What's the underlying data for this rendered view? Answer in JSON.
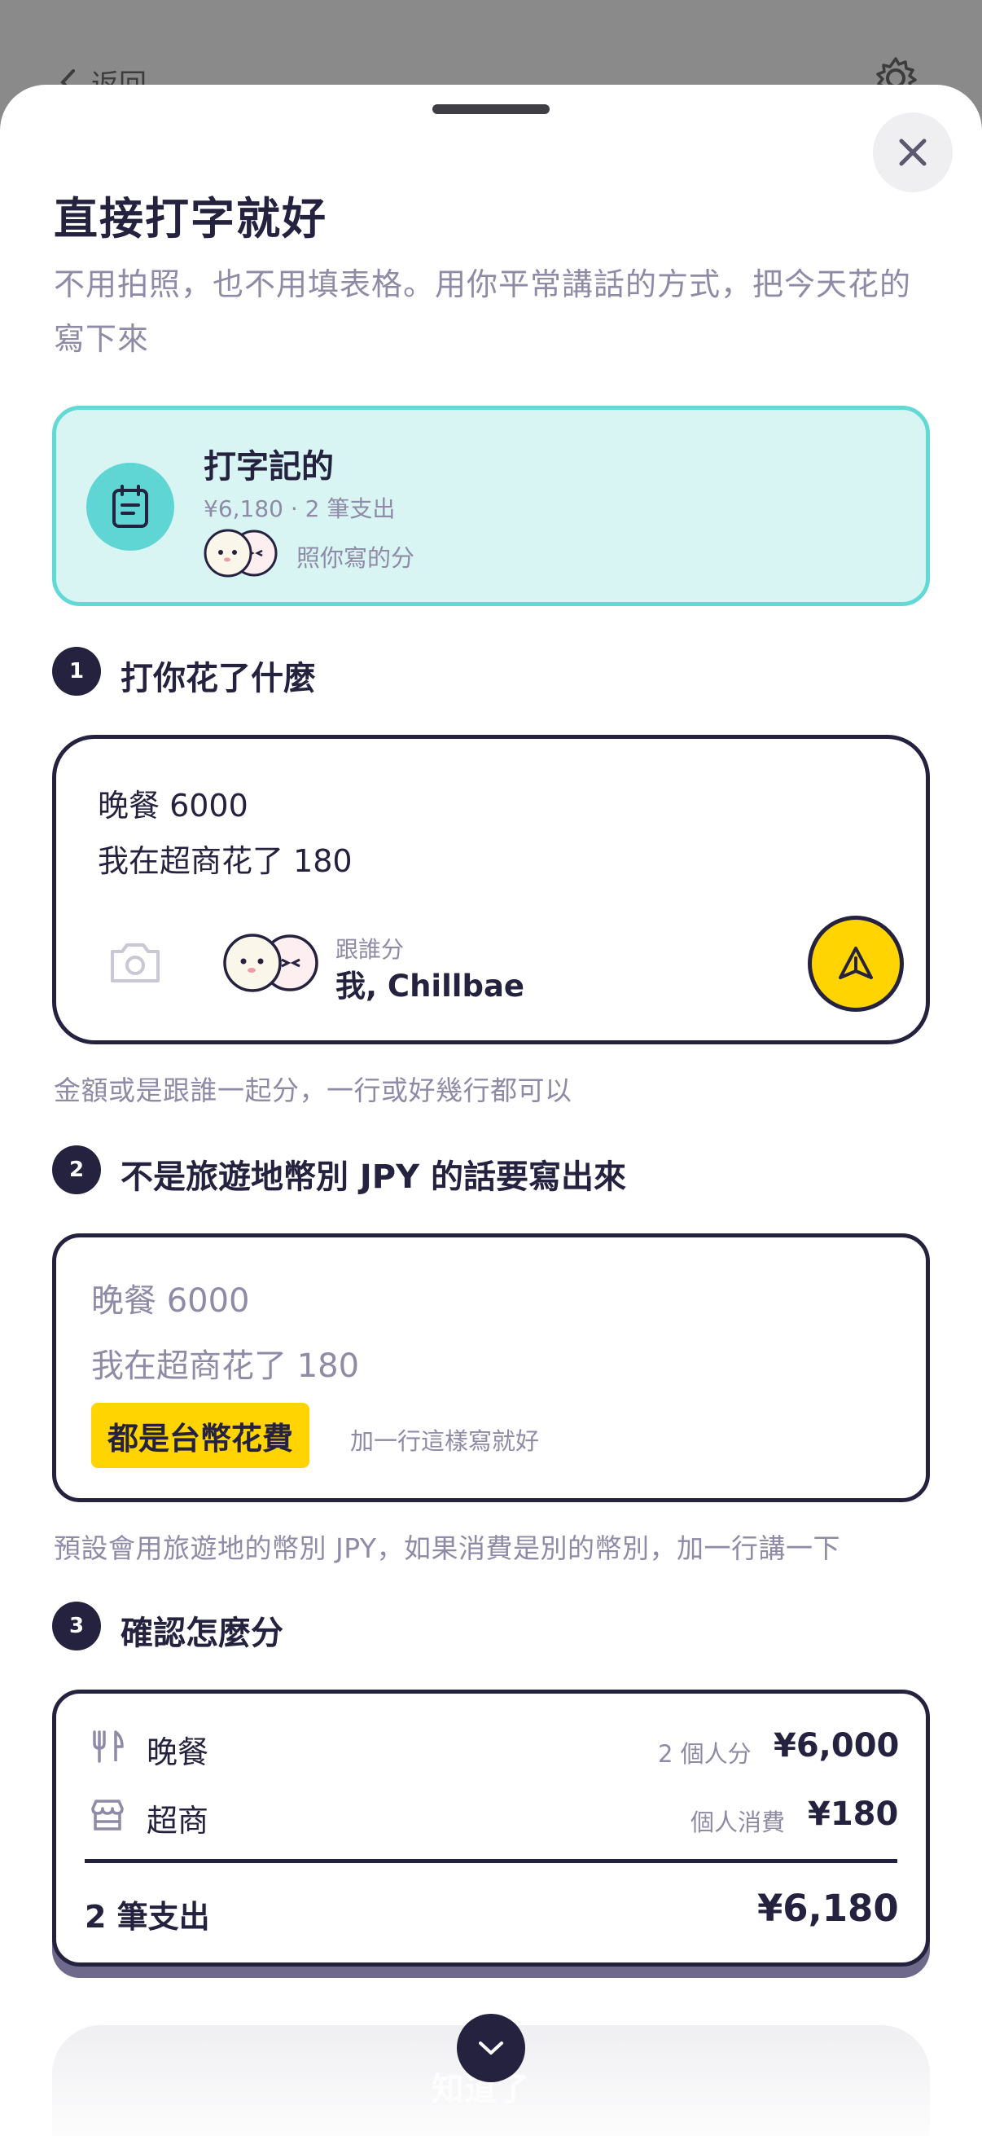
{
  "background_page": {
    "back_label": "返回"
  },
  "sheet": {
    "title": "直接打字就好",
    "subtitle": "不用拍照，也不用填表格。用你平常講話的方式，把今天花的寫下來"
  },
  "mode_card": {
    "name": "打字記的",
    "summary": "¥6,180 · 2 筆支出",
    "split_note": "照你寫的分",
    "icon": "notepad-icon"
  },
  "steps": [
    {
      "number": "1",
      "title": "打你花了什麼"
    },
    {
      "number": "2",
      "title": "不是旅遊地幣別 JPY 的話要寫出來"
    },
    {
      "number": "3",
      "title": "確認怎麼分"
    }
  ],
  "input_card": {
    "lines": [
      "晚餐 6000",
      "我在超商花了 180"
    ],
    "split_label": "跟誰分",
    "split_value": "我, Chillbae",
    "hint": "金額或是跟誰一起分，一行或好幾行都可以"
  },
  "example_card": {
    "lines": [
      "晚餐 6000",
      "我在超商花了 180"
    ],
    "currency_tag": "都是台幣花費",
    "currency_hint": "加一行這樣寫就好",
    "hint": "預設會用旅遊地的幣別 JPY，如果消費是別的幣別，加一行講一下"
  },
  "summary_card": {
    "rows": [
      {
        "icon": "utensils-icon",
        "name": "晚餐",
        "note": "2 個人分",
        "amount": "¥6,000"
      },
      {
        "icon": "store-icon",
        "name": "超商",
        "note": "個人消費",
        "amount": "¥180"
      }
    ],
    "total_label": "2 筆支出",
    "total_amount": "¥6,180"
  },
  "bottom": {
    "faded_button_label": "知道了"
  },
  "colors": {
    "navy": "#25223f",
    "teal": "#63d9d6",
    "teal_bg": "#d8f5f4",
    "yellow": "#ffd400",
    "muted": "#8f8aa6"
  }
}
